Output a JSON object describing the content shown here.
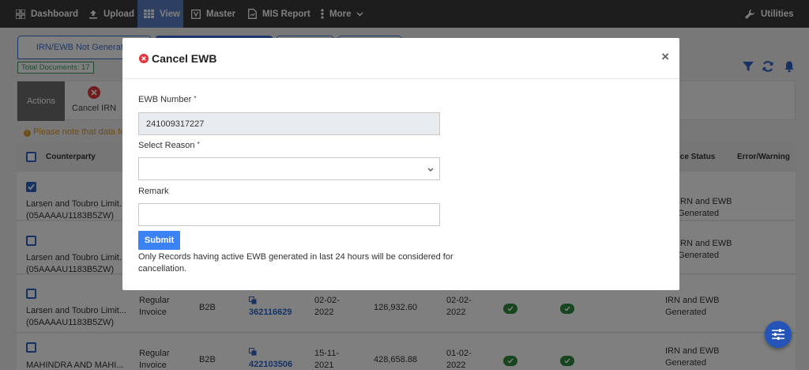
{
  "nav": {
    "dashboard": "Dashboard",
    "upload": "Upload",
    "view": "View",
    "master": "Master",
    "mis_report": "MIS Report",
    "more": "More",
    "utilities": "Utilities"
  },
  "tabs": [
    "IRN/EWB Not Generated"
  ],
  "total_documents": "Total Documents: 17",
  "actions": {
    "label": "Actions",
    "cancel_irn": "Cancel IRN"
  },
  "note": "Please note that data fo",
  "table": {
    "headers": {
      "counterparty": "Counterparty",
      "invoice_status": "ice Status",
      "error_warning": "Error/Warning"
    },
    "rows": [
      {
        "name": "Larsen and Toubro Limit...",
        "gstin": "(05AAAAU1183B5ZW)",
        "checked": true,
        "status_line1": "IRN and EWB",
        "status_line2": "Generated"
      },
      {
        "name": "Larsen and Toubro Limit...",
        "gstin": "(05AAAAU1183B5ZW)",
        "checked": false,
        "status_line1": "IRN and EWB",
        "status_line2": "Generated"
      },
      {
        "name": "Larsen and Toubro Limit...",
        "gstin": "(05AAAAU1183B5ZW)",
        "checked": false,
        "doc_type_line1": "Regular",
        "doc_type_line2": "Invoice",
        "supply_type": "B2B",
        "doc_no": "362116629",
        "date1_line1": "02-02-",
        "date1_line2": "2022",
        "amount": "126,932.60",
        "date2_line1": "02-02-",
        "date2_line2": "2022",
        "status_line1": "IRN and EWB",
        "status_line2": "Generated"
      },
      {
        "name": "MAHINDRA AND MAHI...",
        "gstin": "",
        "checked": false,
        "doc_type_line1": "Regular",
        "doc_type_line2": "Invoice",
        "supply_type": "B2B",
        "doc_no": "422103506",
        "date1_line1": "15-11-",
        "date1_line2": "2021",
        "amount": "428,658.88",
        "date2_line1": "01-02-",
        "date2_line2": "2022",
        "status_line1": "IRN and EWB",
        "status_line2": "Generated"
      }
    ]
  },
  "modal": {
    "title": "Cancel EWB",
    "close": "×",
    "ewb_number_label": "EWB Number",
    "ewb_number_value": "241009317227",
    "select_reason_label": "Select Reason",
    "select_reason_value": "",
    "remark_label": "Remark",
    "remark_value": "",
    "required_mark": "*",
    "submit": "Submit",
    "help_text": "Only Records having active EWB generated in last 24 hours will be considered for cancellation."
  },
  "colors": {
    "navbar": "#3a3a3a",
    "nav_active": "#5a7fc7",
    "primary": "#2c64c8",
    "submit": "#3b82f6",
    "success": "#2e8b3d",
    "danger": "#e0383e",
    "warning": "#e2962a"
  },
  "icons": {
    "dashboard": "grid-icon",
    "upload": "upload-icon",
    "view": "table-icon",
    "master": "master-icon",
    "mis_report": "report-icon",
    "more": "kebab-icon",
    "utilities": "wrench-icon",
    "filter": "filter-icon",
    "refresh": "refresh-icon",
    "notifications": "bell-icon",
    "cancel": "x-circle-icon",
    "settings_fab": "sliders-icon"
  }
}
